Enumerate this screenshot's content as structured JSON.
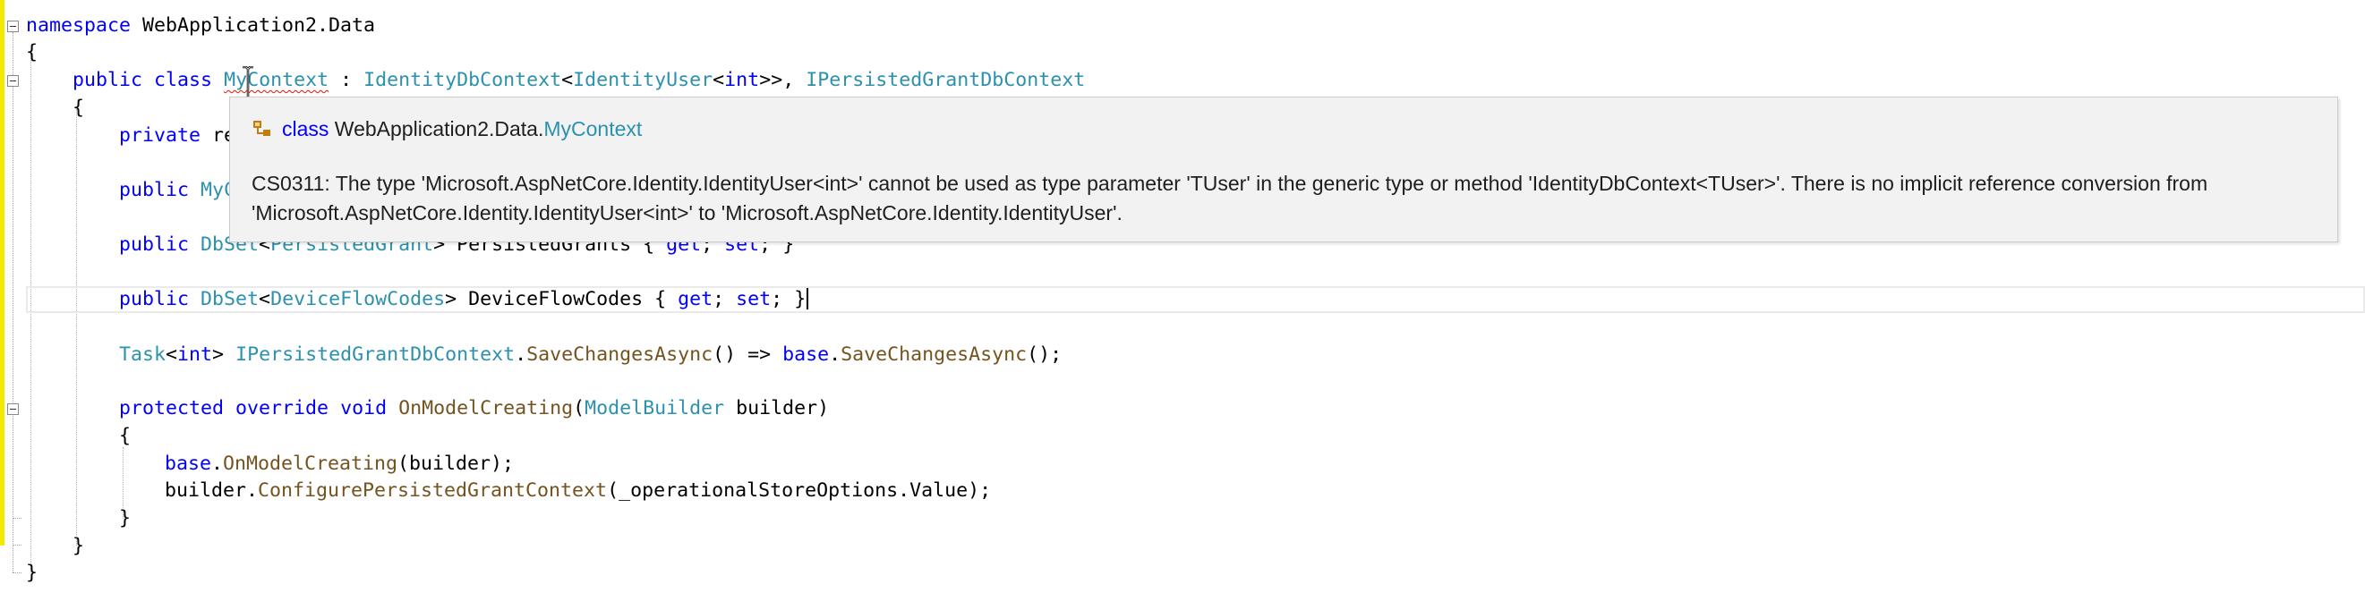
{
  "editor": {
    "lines": {
      "l1": {
        "ns_kw": "namespace",
        "ns_name": " WebApplication2.Data"
      },
      "l2": {
        "brace": "{"
      },
      "l3": {
        "public_kw": "public",
        "class_kw": "class",
        "name_a": "My",
        "name_b": "Context",
        "colon": " : ",
        "base1": "IdentityDbContext",
        "lt": "<",
        "base1_arg": "IdentityUser",
        "lt2": "<",
        "int_kw": "int",
        "gt": ">>, ",
        "base2": "IPersistedGrantDbContext"
      },
      "l4": {
        "brace": "{"
      },
      "l5": {
        "private_kw": "private",
        "rest": " re"
      },
      "l6": {
        "public_kw": "public",
        "rest": " MyC"
      },
      "l7": {
        "public_kw": "public",
        "dbset": "DbSet",
        "lt": "<",
        "type": "PersistedGrant",
        "gt": ">",
        "name": " PersistedGrants ",
        "open": "{ ",
        "get_kw": "get",
        "semi1": "; ",
        "set_kw": "set",
        "semi2": "; ",
        "close": "}"
      },
      "l8": {
        "public_kw": "public",
        "dbset": "DbSet",
        "lt": "<",
        "type": "DeviceFlowCodes",
        "gt": ">",
        "name": " DeviceFlowCodes ",
        "open": "{ ",
        "get_kw": "get",
        "semi1": "; ",
        "set_kw": "set",
        "semi2": "; ",
        "close": "}"
      },
      "l9": {
        "task": "Task",
        "lt": "<",
        "int_kw": "int",
        "gt": "> ",
        "iface": "IPersistedGrantDbContext",
        "dot": ".",
        "method": "SaveChangesAsync",
        "arrow": "() => ",
        "base_kw": "base",
        "dot2": ".",
        "method2": "SaveChangesAsync",
        "end": "();"
      },
      "l10": {
        "protected_kw": "protected",
        "override_kw": "override",
        "void_kw": "void",
        "method": "OnModelCreating",
        "open": "(",
        "param_type": "ModelBuilder",
        "param": " builder)"
      },
      "l11": {
        "brace": "{"
      },
      "l12": {
        "base_kw": "base",
        "dot": ".",
        "method": "OnModelCreating",
        "args": "(builder);"
      },
      "l13": {
        "obj": "builder",
        "dot": ".",
        "method": "ConfigurePersistedGrantContext",
        "args": "(_operationalStoreOptions.Value);"
      },
      "l14": {
        "brace": "}"
      },
      "l15": {
        "brace": "}"
      },
      "l16": {
        "brace": "}"
      }
    }
  },
  "tooltip": {
    "icon": "class-icon",
    "head_kw": "class",
    "head_ns": "WebApplication2.Data.",
    "head_type": "MyContext",
    "error_line1": "CS0311: The type 'Microsoft.AspNetCore.Identity.IdentityUser<int>' cannot be used as type parameter 'TUser' in the generic type or method 'IdentityDbContext<TUser>'. There is no implicit reference conversion from",
    "error_line2": "'Microsoft.AspNetCore.Identity.IdentityUser<int>' to 'Microsoft.AspNetCore.Identity.IdentityUser'."
  },
  "colors": {
    "keyword": "#0000ff",
    "type": "#2b91af",
    "method": "#74531f",
    "error_squiggle": "#e51400",
    "change_bar": "#f5e900"
  }
}
